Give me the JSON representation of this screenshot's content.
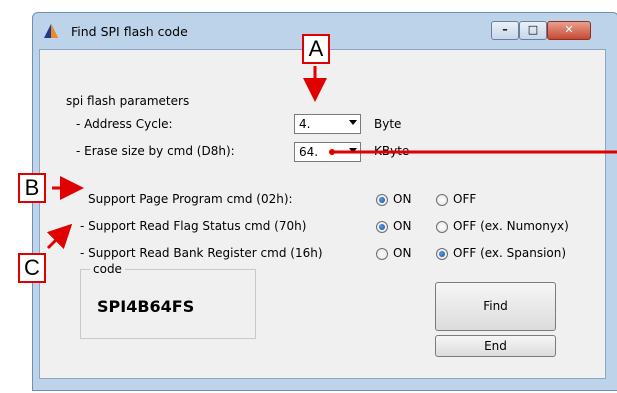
{
  "window": {
    "title": "Find SPI flash code"
  },
  "params": {
    "heading": "spi flash parameters",
    "address_label": "- Address Cycle:",
    "address_value": "4.",
    "address_unit": "Byte",
    "erase_label": "- Erase size by cmd (D8h):",
    "erase_value": "64.",
    "erase_unit": "KByte"
  },
  "options": [
    {
      "label": "Support Page Program cmd (02h):",
      "on_label": "ON",
      "off_label": "OFF",
      "selected": "on"
    },
    {
      "label": "- Support Read Flag Status cmd (70h)",
      "on_label": "ON",
      "off_label": "OFF (ex. Numonyx)",
      "selected": "on"
    },
    {
      "label": "- Support Read Bank Register cmd (16h)",
      "on_label": "ON",
      "off_label": "OFF (ex. Spansion)",
      "selected": "off"
    }
  ],
  "code_group": {
    "legend": "code",
    "value": "SPI4B64FS"
  },
  "buttons": {
    "find": "Find",
    "end": "End"
  },
  "callouts": {
    "a": "A",
    "b": "B",
    "c": "C"
  },
  "colors": {
    "callout": "#e00000",
    "titlebar": "#bcd3ea",
    "client": "#f0f0f0"
  }
}
